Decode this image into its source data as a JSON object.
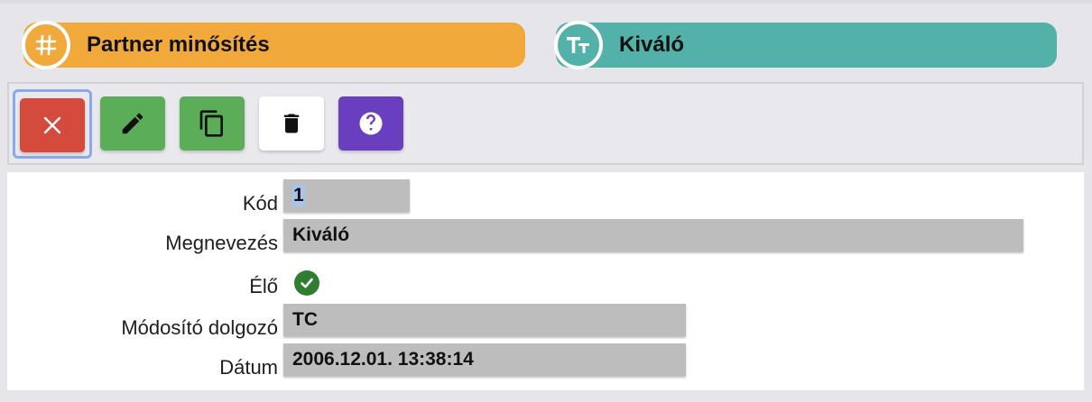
{
  "header": {
    "entity_title": "Partner minősítés",
    "entity_icon": "hash-icon",
    "record_title": "Kiváló",
    "record_icon": "text-type-icon",
    "colors": {
      "orange": "#f2a93b",
      "teal": "#52b1a8"
    }
  },
  "toolbar": {
    "buttons": [
      {
        "name": "close",
        "icon": "close-icon",
        "color": "#d44a3c"
      },
      {
        "name": "edit",
        "icon": "pencil-icon",
        "color": "#5cad57"
      },
      {
        "name": "copy",
        "icon": "copy-icon",
        "color": "#5cad57"
      },
      {
        "name": "delete",
        "icon": "trash-icon",
        "color": "#ffffff"
      },
      {
        "name": "help",
        "icon": "help-icon",
        "color": "#6a3fbf"
      }
    ]
  },
  "form": {
    "code": {
      "label": "Kód",
      "value": "1"
    },
    "name": {
      "label": "Megnevezés",
      "value": "Kiváló"
    },
    "active": {
      "label": "Élő",
      "checked": true,
      "icon": "check-circle-icon"
    },
    "modifier": {
      "label": "Módosító dolgozó",
      "value": "TC"
    },
    "date": {
      "label": "Dátum",
      "value": "2006.12.01. 13:38:14"
    }
  }
}
